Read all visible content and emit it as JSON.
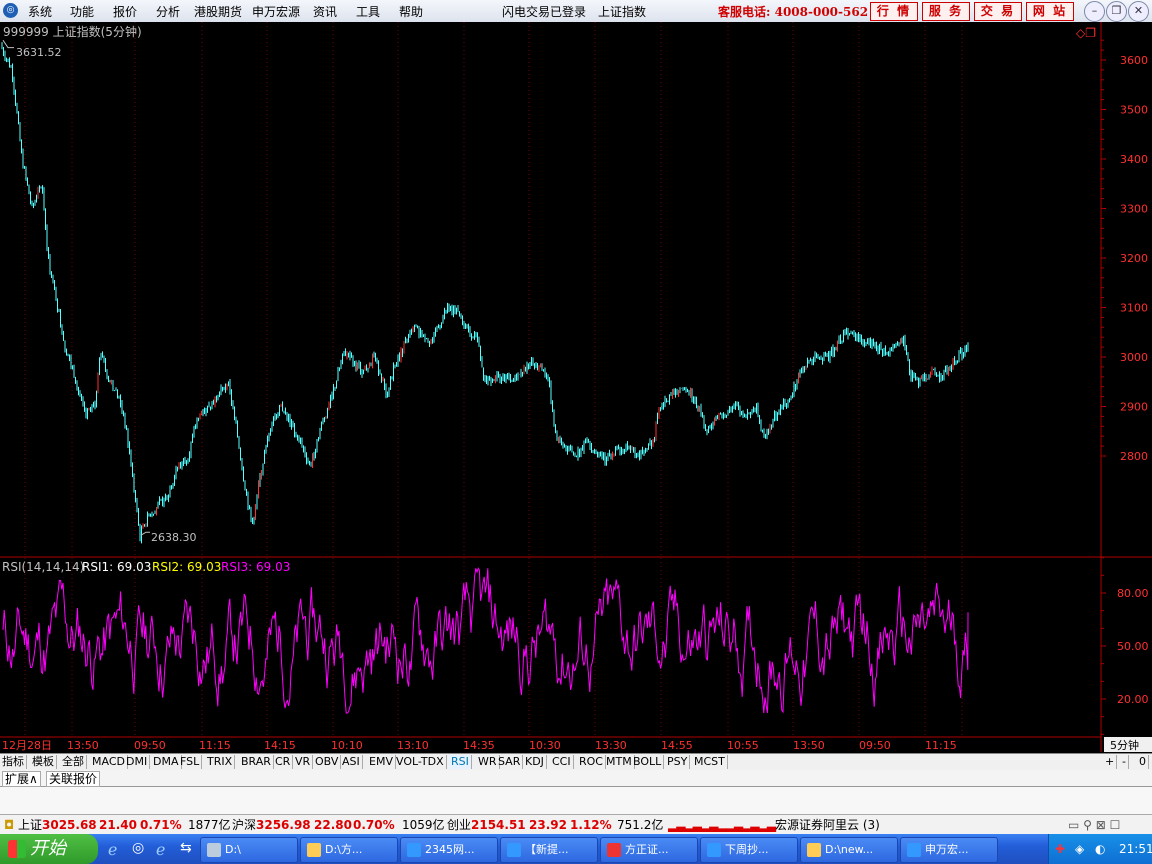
{
  "menubar": {
    "items": [
      "系统",
      "功能",
      "报价",
      "分析",
      "港股期货",
      "申万宏源",
      "资讯",
      "工具",
      "帮助"
    ],
    "status_login": "闪电交易已登录",
    "status_security": "上证指数",
    "hotline": "客服电话: 4008-000-562",
    "buttons": [
      "行 情",
      "服 务",
      "交 易",
      "网 站"
    ],
    "window_buttons": [
      "minimize",
      "restore",
      "close"
    ]
  },
  "chart": {
    "header": "999999 上证指数(5分钟)",
    "max_label": "3631.52",
    "min_label": "2638.30",
    "y_ticks": [
      "3600",
      "3500",
      "3400",
      "3300",
      "3200",
      "3100",
      "3000",
      "2900",
      "2800"
    ],
    "x_ticks": [
      "12月28日",
      "13:50",
      "09:50",
      "11:15",
      "14:15",
      "10:10",
      "13:10",
      "14:35",
      "10:30",
      "13:30",
      "14:55",
      "10:55",
      "13:50",
      "09:50",
      "11:15"
    ],
    "period_label": "5分钟"
  },
  "chart_data": [
    {
      "type": "line",
      "title": "999999 上证指数(5分钟)",
      "ylim": [
        2600,
        3660
      ],
      "y_ticks": [
        3600,
        3500,
        3400,
        3300,
        3200,
        3100,
        3000,
        2900,
        2800
      ],
      "annotations": {
        "high": 3631.52,
        "low": 2638.3
      },
      "anchors": [
        [
          0,
          3631.52
        ],
        [
          12,
          3580
        ],
        [
          22,
          3400
        ],
        [
          32,
          3300
        ],
        [
          42,
          3350
        ],
        [
          48,
          3200
        ],
        [
          58,
          3100
        ],
        [
          65,
          3020
        ],
        [
          75,
          2960
        ],
        [
          85,
          2880
        ],
        [
          95,
          2900
        ],
        [
          100,
          3010
        ],
        [
          108,
          2960
        ],
        [
          118,
          2920
        ],
        [
          124,
          2880
        ],
        [
          130,
          2800
        ],
        [
          136,
          2700
        ],
        [
          140,
          2638.3
        ],
        [
          148,
          2680
        ],
        [
          158,
          2700
        ],
        [
          168,
          2720
        ],
        [
          178,
          2780
        ],
        [
          188,
          2800
        ],
        [
          198,
          2880
        ],
        [
          208,
          2900
        ],
        [
          218,
          2920
        ],
        [
          228,
          2950
        ],
        [
          236,
          2860
        ],
        [
          244,
          2750
        ],
        [
          252,
          2660
        ],
        [
          262,
          2780
        ],
        [
          272,
          2870
        ],
        [
          282,
          2900
        ],
        [
          292,
          2860
        ],
        [
          300,
          2830
        ],
        [
          310,
          2780
        ],
        [
          318,
          2840
        ],
        [
          328,
          2900
        ],
        [
          336,
          2950
        ],
        [
          344,
          3010
        ],
        [
          354,
          2990
        ],
        [
          364,
          2970
        ],
        [
          374,
          3000
        ],
        [
          382,
          2960
        ],
        [
          386,
          2920
        ],
        [
          394,
          2980
        ],
        [
          404,
          3020
        ],
        [
          412,
          3060
        ],
        [
          422,
          3050
        ],
        [
          432,
          3030
        ],
        [
          440,
          3070
        ],
        [
          448,
          3100
        ],
        [
          458,
          3090
        ],
        [
          468,
          3050
        ],
        [
          478,
          3040
        ],
        [
          484,
          2950
        ],
        [
          494,
          2960
        ],
        [
          504,
          2960
        ],
        [
          514,
          2950
        ],
        [
          524,
          2980
        ],
        [
          532,
          2990
        ],
        [
          540,
          2980
        ],
        [
          548,
          2960
        ],
        [
          556,
          2840
        ],
        [
          566,
          2820
        ],
        [
          576,
          2800
        ],
        [
          586,
          2830
        ],
        [
          596,
          2810
        ],
        [
          606,
          2790
        ],
        [
          616,
          2810
        ],
        [
          626,
          2820
        ],
        [
          636,
          2800
        ],
        [
          646,
          2810
        ],
        [
          654,
          2840
        ],
        [
          660,
          2900
        ],
        [
          670,
          2920
        ],
        [
          680,
          2930
        ],
        [
          690,
          2930
        ],
        [
          700,
          2890
        ],
        [
          708,
          2850
        ],
        [
          716,
          2880
        ],
        [
          726,
          2890
        ],
        [
          736,
          2900
        ],
        [
          746,
          2880
        ],
        [
          756,
          2900
        ],
        [
          764,
          2830
        ],
        [
          772,
          2870
        ],
        [
          780,
          2900
        ],
        [
          790,
          2910
        ],
        [
          798,
          2960
        ],
        [
          808,
          2990
        ],
        [
          818,
          3000
        ],
        [
          828,
          3000
        ],
        [
          838,
          3030
        ],
        [
          846,
          3050
        ],
        [
          856,
          3040
        ],
        [
          866,
          3030
        ],
        [
          876,
          3020
        ],
        [
          886,
          3010
        ],
        [
          896,
          3020
        ],
        [
          904,
          3040
        ],
        [
          910,
          2960
        ],
        [
          920,
          2950
        ],
        [
          930,
          2970
        ],
        [
          940,
          2960
        ],
        [
          950,
          2980
        ],
        [
          958,
          3000
        ],
        [
          968,
          3020
        ]
      ]
    },
    {
      "type": "line",
      "title": "RSI(14,14,14)",
      "ylim": [
        0,
        100
      ],
      "y_ticks": [
        80.0,
        50.0,
        20.0
      ],
      "series": [
        {
          "name": "RSI1",
          "last": 69.03,
          "color": "#ffffff"
        },
        {
          "name": "RSI2",
          "last": 69.03,
          "color": "#ffff00"
        },
        {
          "name": "RSI3",
          "last": 69.03,
          "color": "#ff00ff"
        }
      ]
    }
  ],
  "rsi_header": {
    "label": "RSI(14,14,14)",
    "rsi1": "RSI1: 69.03",
    "rsi2": "RSI2: 69.03",
    "rsi3": "RSI3: 69.03"
  },
  "rsi_y_ticks": [
    "80.00",
    "50.00",
    "20.00"
  ],
  "indicator_tabs": [
    "指标",
    "模板",
    "全部",
    "MACD",
    "DMI",
    "DMA",
    "FSL",
    "TRIX",
    "BRAR",
    "CR",
    "VR",
    "OBV",
    "ASI",
    "EMV",
    "VOL-TDX",
    "RSI",
    "WR",
    "SAR",
    "KDJ",
    "CCI",
    "ROC",
    "MTM",
    "BOLL",
    "PSY",
    "MCST"
  ],
  "active_tab": "RSI",
  "tab_nav": [
    "+",
    "-",
    "0"
  ],
  "ext_tabs": [
    "扩展∧",
    "关联报价"
  ],
  "ticker": {
    "sh_label": "上证",
    "sh_value": "3025.68",
    "sh_change": "21.40",
    "sh_pct": "0.71%",
    "sh_amount": "1877亿",
    "hs_label": "沪深",
    "hs_value": "3256.98",
    "hs_change": "22.80",
    "hs_pct": "0.70%",
    "hs_amount": "1059亿",
    "cy_label": "创业",
    "cy_value": "2154.51",
    "cy_change": "23.92",
    "cy_pct": "1.12%",
    "cy_amount": "751.2亿",
    "server": "宏源证券阿里云 (3)"
  },
  "taskbar": {
    "start": "开始",
    "tasks": [
      "D:\\",
      "D:\\方...",
      "2345网...",
      "【新提...",
      "方正证...",
      "下周抄...",
      "D:\\new...",
      "申万宏..."
    ],
    "clock": "21:51"
  }
}
